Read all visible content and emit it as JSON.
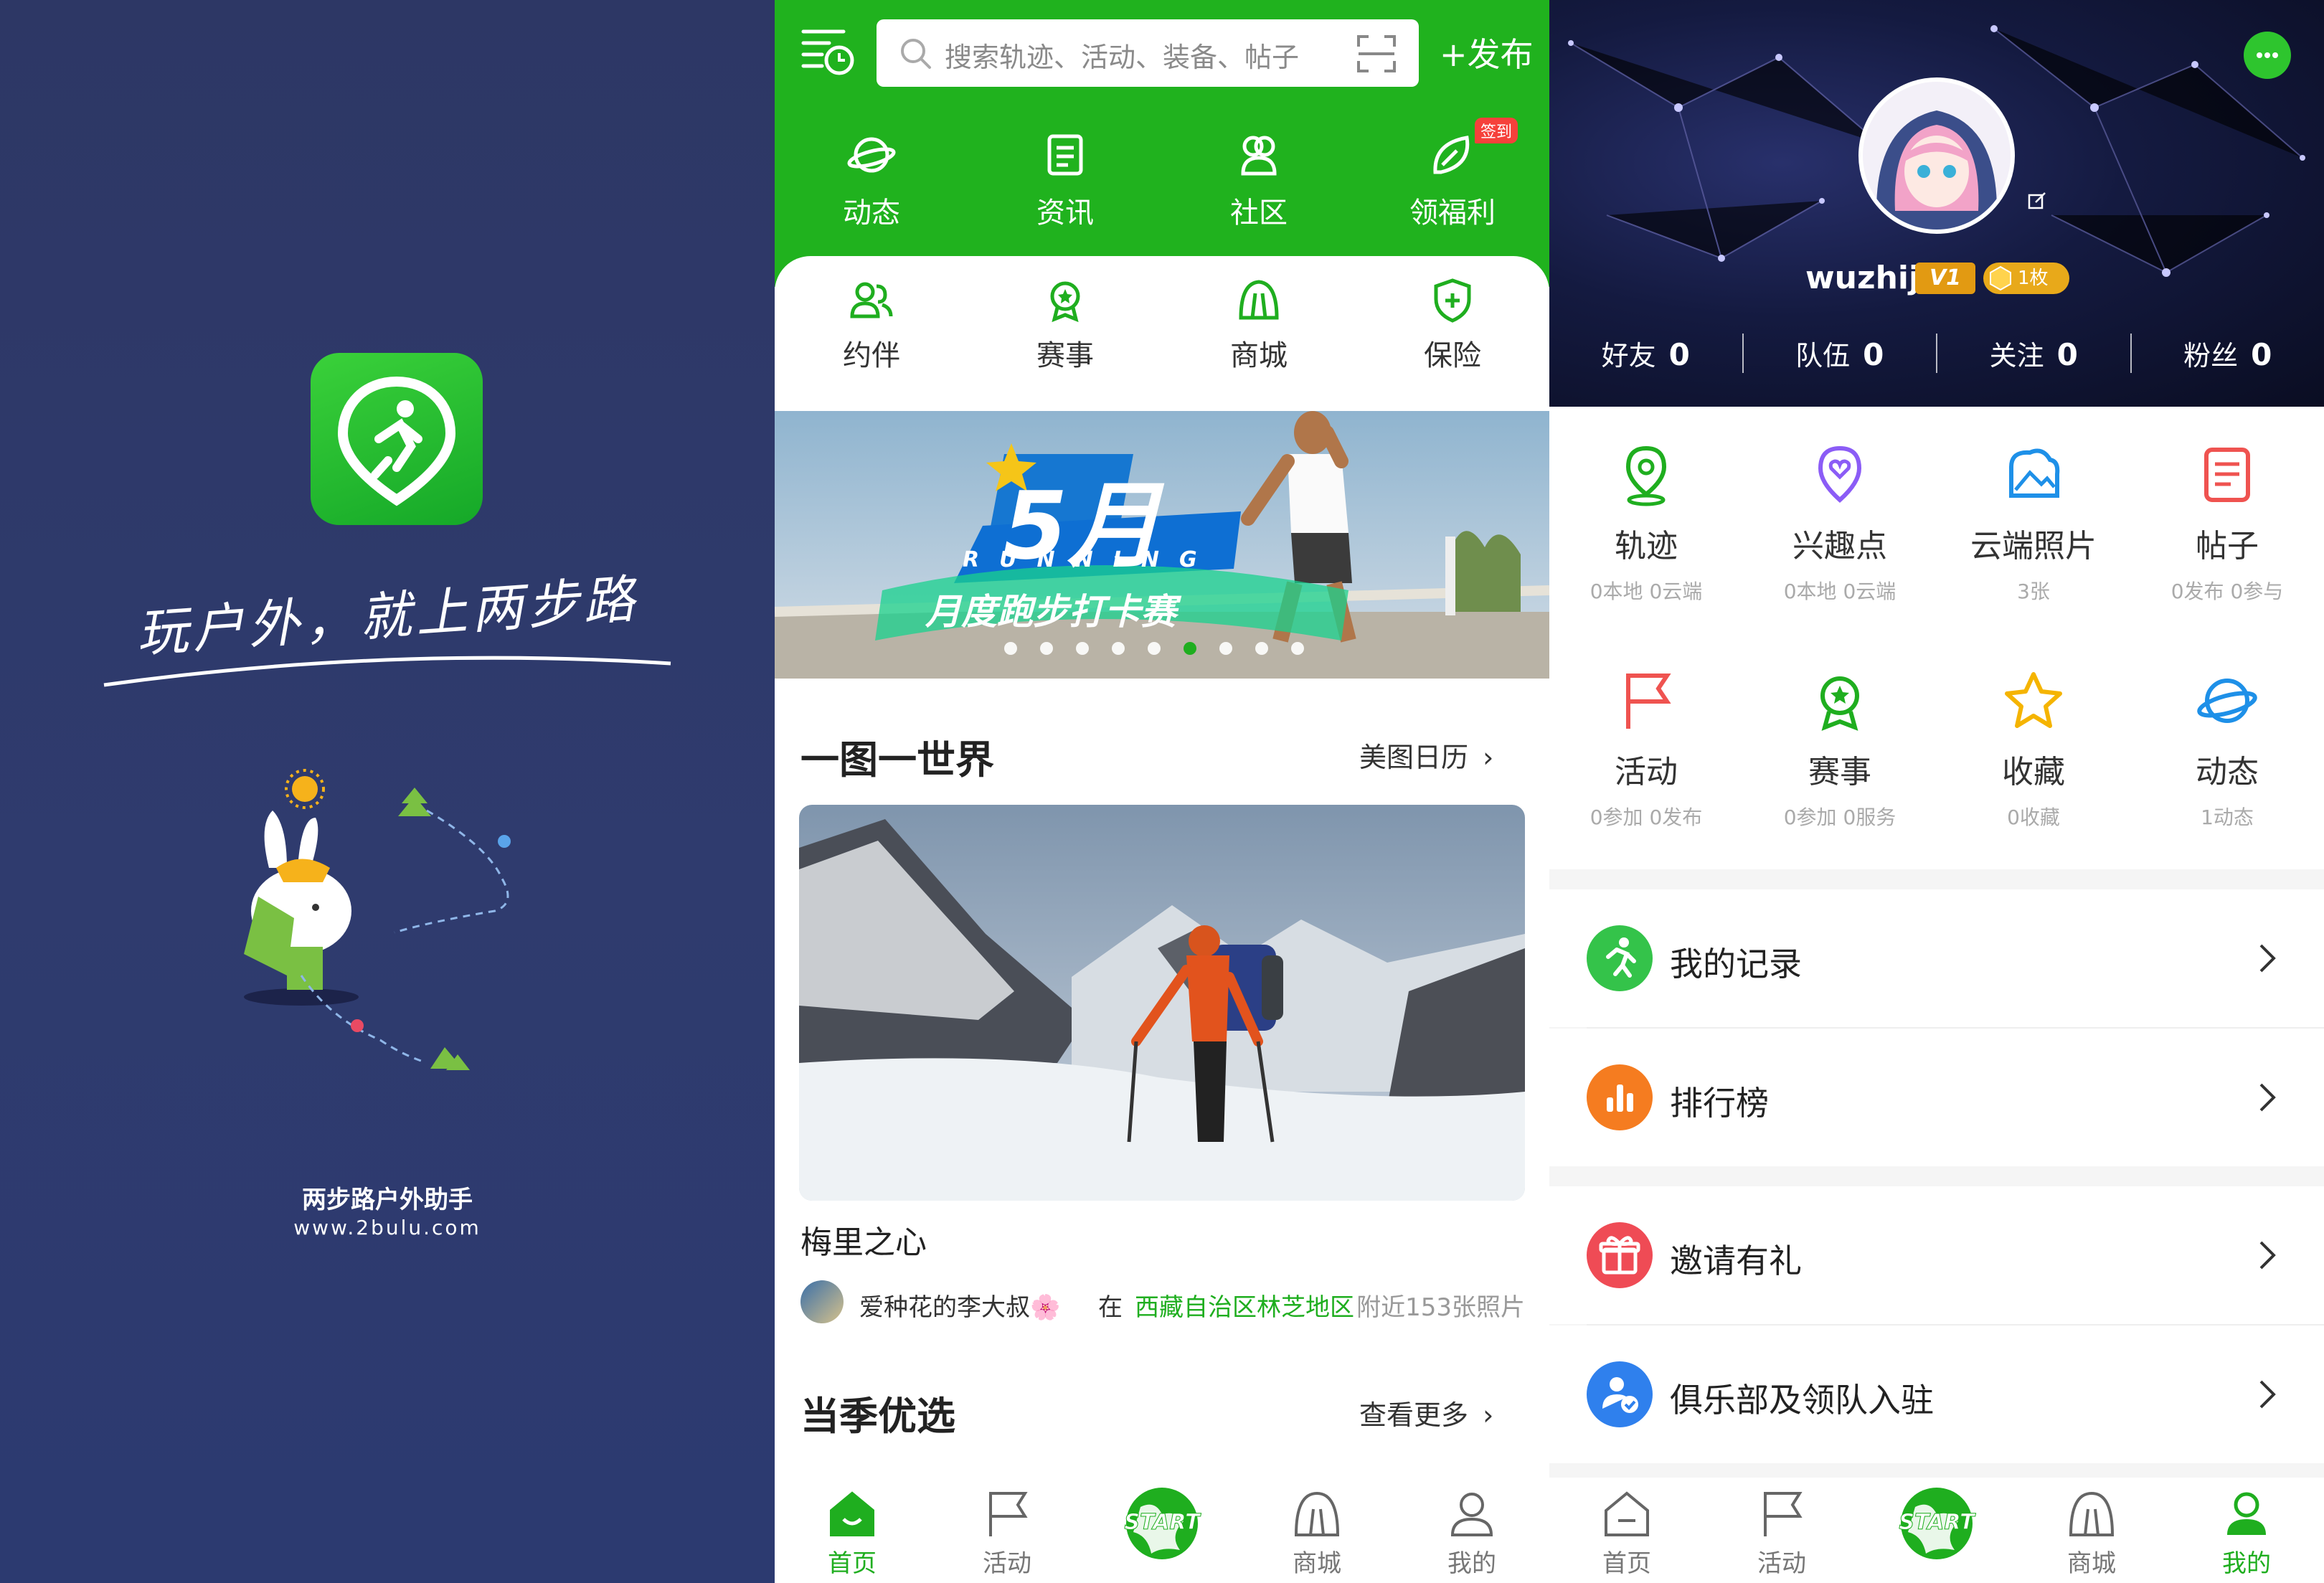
{
  "splash": {
    "slogan": "玩户外，就上两步路",
    "brand": "两步路户外助手",
    "url": "www.2bulu.com"
  },
  "home": {
    "search": {
      "placeholder": "搜索轨迹、活动、装备、帖子"
    },
    "publish_label": "+发布",
    "top_nav": [
      {
        "label": "动态",
        "icon": "planet-icon"
      },
      {
        "label": "资讯",
        "icon": "news-icon"
      },
      {
        "label": "社区",
        "icon": "community-icon"
      },
      {
        "label": "领福利",
        "icon": "leaf-icon",
        "badge": "签到"
      }
    ],
    "second_nav": [
      {
        "label": "约伴",
        "icon": "companions-icon"
      },
      {
        "label": "赛事",
        "icon": "medal-icon"
      },
      {
        "label": "商城",
        "icon": "shop-icon"
      },
      {
        "label": "保险",
        "icon": "shield-icon"
      }
    ],
    "banner": {
      "big": "5月",
      "running": "RUNNING",
      "subtitle": "月度跑步打卡赛",
      "dots_total": 9,
      "dots_active_index": 5
    },
    "section1": {
      "title": "一图一世界",
      "more": "美图日历"
    },
    "photo": {
      "place": "梅里之心",
      "author": "爱种花的李大叔🌸",
      "at": "在",
      "location": "西藏自治区林芝地区",
      "nearby": "附近153张照片"
    },
    "section2": {
      "title": "当季优选",
      "more": "查看更多"
    }
  },
  "tabbar": {
    "tabs": [
      {
        "label": "首页",
        "icon": "home-icon"
      },
      {
        "label": "活动",
        "icon": "flag-icon"
      },
      {
        "label": "START",
        "icon": "start-globe-icon"
      },
      {
        "label": "商城",
        "icon": "shop-icon"
      },
      {
        "label": "我的",
        "icon": "user-icon"
      }
    ],
    "home_active": "首页",
    "profile_active": "我的"
  },
  "profile": {
    "username": "wuzhij",
    "level": "V1",
    "coin": "1枚",
    "stats": [
      {
        "label": "好友",
        "value": "0"
      },
      {
        "label": "队伍",
        "value": "0"
      },
      {
        "label": "关注",
        "value": "0"
      },
      {
        "label": "粉丝",
        "value": "0"
      }
    ],
    "grid": [
      {
        "label": "轨迹",
        "sub": "0本地 0云端",
        "icon": "location-pin-icon",
        "color": "#1fae1f"
      },
      {
        "label": "兴趣点",
        "sub": "0本地 0云端",
        "icon": "heart-pin-icon",
        "color": "#8b5cf6"
      },
      {
        "label": "云端照片",
        "sub": "3张",
        "icon": "cloud-photo-icon",
        "color": "#1e90e8"
      },
      {
        "label": "帖子",
        "sub": "0发布 0参与",
        "icon": "post-icon",
        "color": "#ef5350"
      },
      {
        "label": "活动",
        "sub": "0参加 0发布",
        "icon": "flag-icon",
        "color": "#ef5350"
      },
      {
        "label": "赛事",
        "sub": "0参加 0服务",
        "icon": "medal-icon",
        "color": "#1fae1f"
      },
      {
        "label": "收藏",
        "sub": "0收藏",
        "icon": "star-icon",
        "color": "#f5b400"
      },
      {
        "label": "动态",
        "sub": "1动态",
        "icon": "planet-icon",
        "color": "#1e90e8"
      }
    ],
    "menu": [
      {
        "label": "我的记录",
        "icon": "runner-icon",
        "color": "#34c34a"
      },
      {
        "label": "排行榜",
        "icon": "bar-chart-icon",
        "color": "#f57c20"
      },
      {
        "label": "邀请有礼",
        "icon": "gift-icon",
        "color": "#ef4b55"
      },
      {
        "label": "俱乐部及领队入驻",
        "icon": "club-icon",
        "color": "#2f80ed"
      }
    ]
  }
}
